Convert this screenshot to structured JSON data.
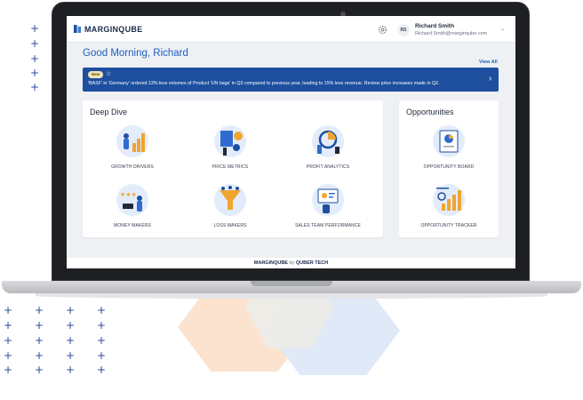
{
  "app": {
    "brand": "MARGINQUBE",
    "user": {
      "initials": "RS",
      "name": "Richard Smith",
      "email": "Richard.Smith@marginqube.com"
    }
  },
  "greeting": "Good Morning, Richard",
  "view_all": "View All",
  "alert": {
    "badge": "New",
    "text": "'BASF' in 'Germany' ordered 13% less volumes of Product 'UN bags' in Q3 compared to previous year, leading to 15% less revenue. Review price increases made in Q2."
  },
  "deep_dive": {
    "title": "Deep Dive",
    "tiles": [
      {
        "label": "GROWTH DRIVERS",
        "icon": "growth-drivers-illustration"
      },
      {
        "label": "PRICE METRICS",
        "icon": "price-metrics-illustration"
      },
      {
        "label": "PROFIT ANALYTICS",
        "icon": "profit-analytics-illustration"
      },
      {
        "label": "MONEY MAKERS",
        "icon": "money-makers-illustration"
      },
      {
        "label": "LOSS MAKERS",
        "icon": "loss-makers-illustration"
      },
      {
        "label": "SALES TEAM PERFORMANCE",
        "icon": "sales-team-performance-illustration"
      }
    ]
  },
  "opportunities": {
    "title": "Opportunities",
    "tiles": [
      {
        "label": "OPPORTUNITY BOARD",
        "icon": "opportunity-board-illustration"
      },
      {
        "label": "OPPORTUNITY TRACKER",
        "icon": "opportunity-tracker-illustration"
      }
    ]
  },
  "footer": {
    "brand": "MARGINQUBE",
    "by": "by",
    "company": "QUBER TECH"
  },
  "colors": {
    "primary": "#1d4f9e",
    "accent": "#f0a530",
    "decor_plus": "#2f4a9e",
    "hex_orange": "#fbe3cf",
    "hex_blue": "#dfe9f8"
  }
}
